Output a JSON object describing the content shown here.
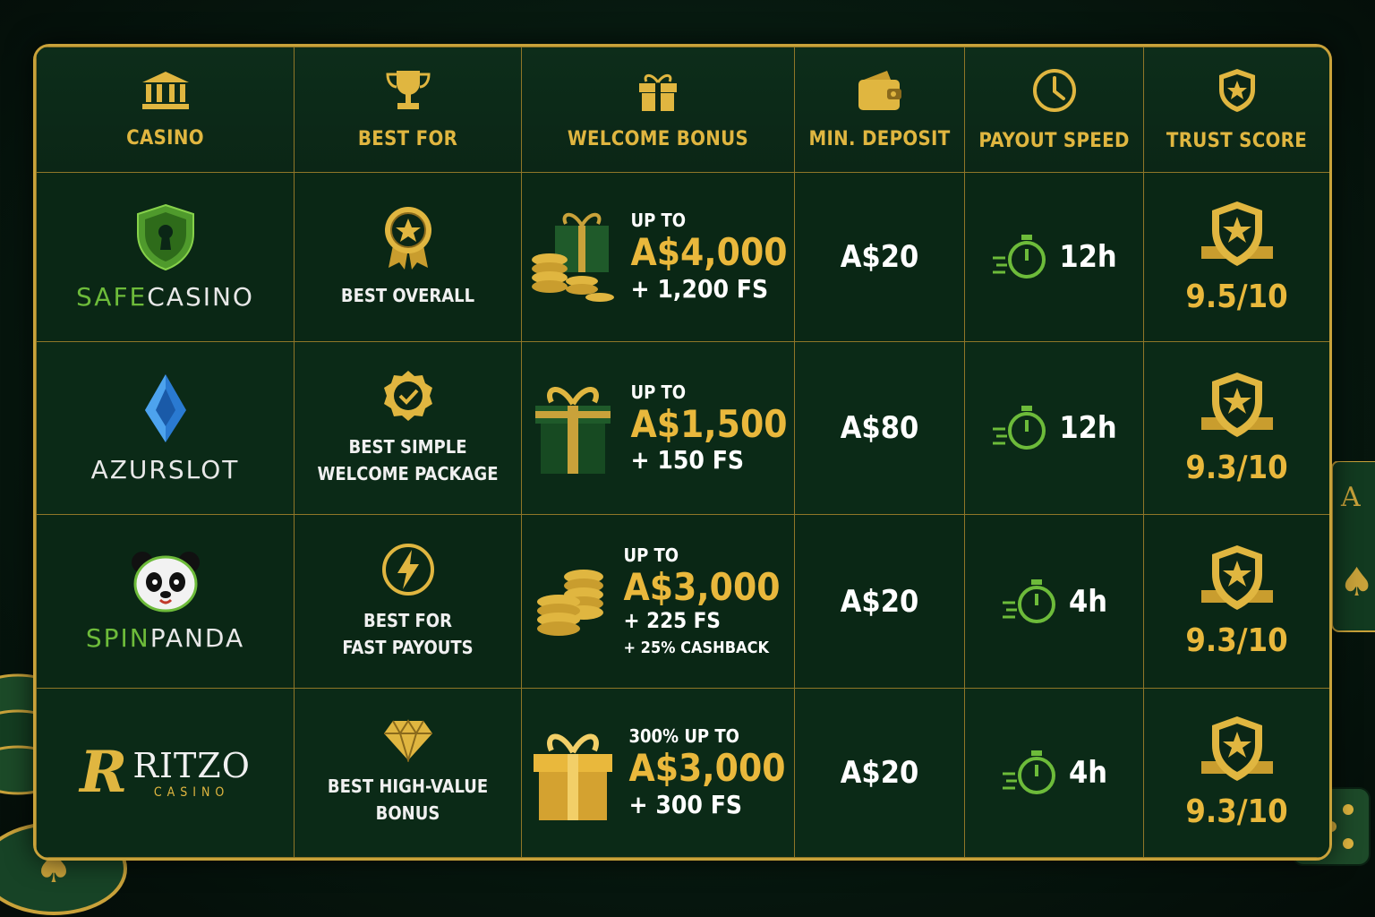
{
  "colors": {
    "gold": "#e0b640",
    "green": "#6dbb3a",
    "border": "#8f7628"
  },
  "headers": [
    {
      "label": "CASINO",
      "icon": "bank-icon"
    },
    {
      "label": "BEST FOR",
      "icon": "trophy-icon"
    },
    {
      "label": "WELCOME BONUS",
      "icon": "gift-icon"
    },
    {
      "label": "MIN. DEPOSIT",
      "icon": "wallet-icon"
    },
    {
      "label": "PAYOUT SPEED",
      "icon": "clock-icon"
    },
    {
      "label": "TRUST SCORE",
      "icon": "shield-star-icon"
    }
  ],
  "rows": [
    {
      "name_a": "SAFE",
      "name_b": "CASINO",
      "best1": "BEST OVERALL",
      "best2": "",
      "upto": "UP TO",
      "amount": "A$4,000",
      "fs": "+ 1,200 FS",
      "extra": "",
      "deposit": "A$20",
      "payout": "12h",
      "score": "9.5/10"
    },
    {
      "name_a": "",
      "name_b": "AZURSLOT",
      "best1": "BEST SIMPLE",
      "best2": "WELCOME PACKAGE",
      "upto": "UP TO",
      "amount": "A$1,500",
      "fs": "+ 150 FS",
      "extra": "",
      "deposit": "A$80",
      "payout": "12h",
      "score": "9.3/10"
    },
    {
      "name_a": "SPIN",
      "name_b": "PANDA",
      "best1": "BEST FOR",
      "best2": "FAST PAYOUTS",
      "upto": "UP TO",
      "amount": "A$3,000",
      "fs": "+ 225 FS",
      "extra": "+ 25% CASHBACK",
      "deposit": "A$20",
      "payout": "4h",
      "score": "9.3/10"
    },
    {
      "name_a": "RITZO",
      "name_b": "CASINO",
      "best1": "BEST HIGH-VALUE",
      "best2": "BONUS",
      "upto": "300% UP TO",
      "amount": "A$3,000",
      "fs": "+ 300 FS",
      "extra": "",
      "deposit": "A$20",
      "payout": "4h",
      "score": "9.3/10"
    }
  ]
}
